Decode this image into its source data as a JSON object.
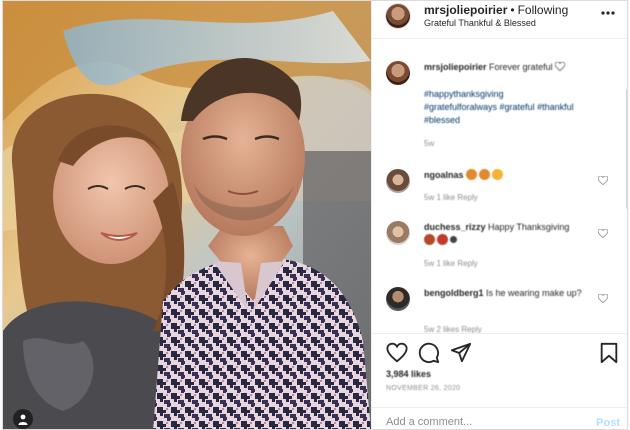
{
  "post": {
    "username": "mrsjoliepoirier",
    "separator": "•",
    "follow_state": "Following",
    "subtitle": "Grateful Thankful & Blessed"
  },
  "comments": [
    {
      "user": "mrsjoliepoirier",
      "text": "Forever grateful",
      "tags": "#happythanksgiving #gratefulforalways #grateful #thankful #blessed",
      "meta": "5w",
      "emoji": [
        "heart"
      ]
    },
    {
      "user": "ngoalnas",
      "text": "",
      "meta": "5w   1 like   Reply",
      "emoji": [
        "#e08a2c",
        "#e08a2c",
        "#f2b233"
      ]
    },
    {
      "user": "duchess_rizzy",
      "text": "Happy Thanksgiving",
      "meta": "5w   1 like   Reply",
      "emoji": [
        "#b5482e",
        "#c0392b",
        "#444"
      ]
    },
    {
      "user": "bengoldberg1",
      "text": "Is he wearing make up?",
      "meta": "5w   2 likes   Reply"
    }
  ],
  "actions": {
    "likes": "3,984 likes",
    "date": "NOVEMBER 26, 2020"
  },
  "composer": {
    "placeholder": "Add a comment...",
    "post_label": "Post"
  },
  "colors": {
    "link": "#00376b",
    "post_disabled": "#b2dffc",
    "meta_gray": "#8e8e8e"
  },
  "icons": [
    "more-icon",
    "heart-icon",
    "comment-icon",
    "share-icon",
    "bookmark-icon",
    "user-tag-icon"
  ]
}
